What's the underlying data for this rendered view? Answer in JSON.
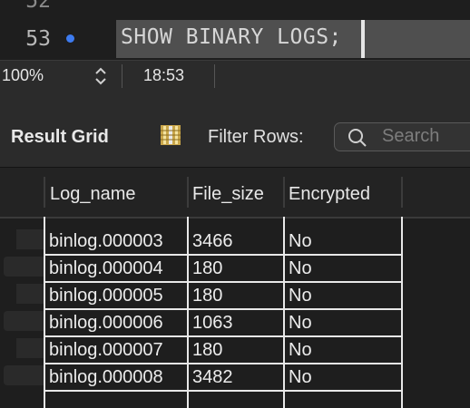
{
  "editor": {
    "prev_line_number": "52",
    "line_number": "53",
    "code": "SHOW BINARY LOGS;"
  },
  "status": {
    "zoom": "100%",
    "cursor_position": "18:53"
  },
  "toolbar": {
    "result_grid_label": "Result Grid",
    "filter_rows_label": "Filter Rows:",
    "search_placeholder": "Search"
  },
  "columns": [
    "Log_name",
    "File_size",
    "Encrypted"
  ],
  "rows": [
    [
      "binlog.000003",
      "3466",
      "No"
    ],
    [
      "binlog.000004",
      "180",
      "No"
    ],
    [
      "binlog.000005",
      "180",
      "No"
    ],
    [
      "binlog.000006",
      "1063",
      "No"
    ],
    [
      "binlog.000007",
      "180",
      "No"
    ],
    [
      "binlog.000008",
      "3482",
      "No"
    ]
  ],
  "colors": {
    "breakpoint": "#3d7bf0",
    "selection": "#4f4f4f"
  }
}
